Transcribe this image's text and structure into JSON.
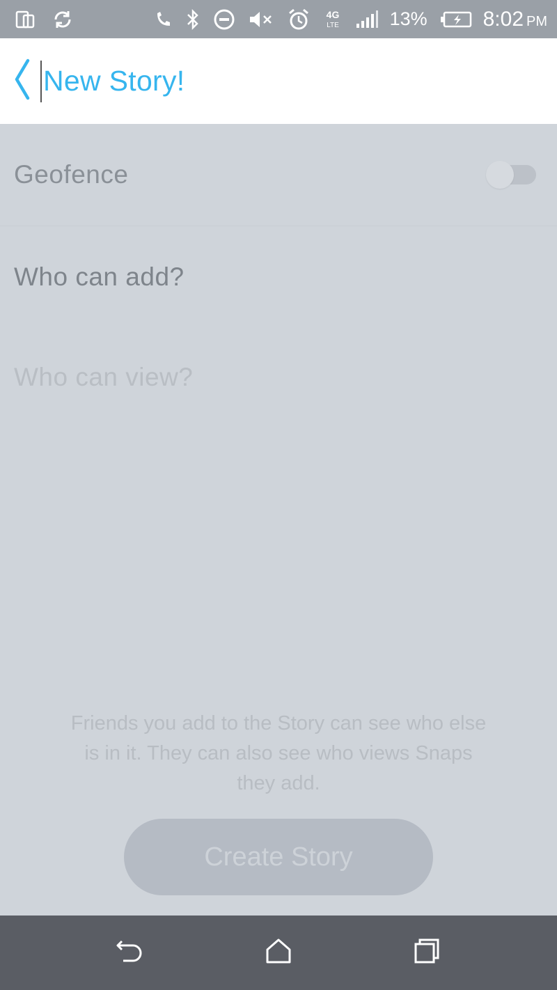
{
  "status_bar": {
    "battery_percent": "13%",
    "time": "8:02",
    "ampm": "PM",
    "network_type": "4G LTE",
    "icons": [
      "screen-mirror-icon",
      "sync-icon",
      "call-icon",
      "bluetooth-icon",
      "do-not-disturb-icon",
      "mute-icon",
      "alarm-icon",
      "network-type-icon",
      "signal-icon",
      "battery-charging-icon"
    ]
  },
  "header": {
    "title": "New Story!",
    "back_icon": "chevron-left-icon"
  },
  "settings": {
    "geofence_label": "Geofence",
    "geofence_enabled": false,
    "who_can_add_label": "Who can add?",
    "who_can_view_label": "Who can view?"
  },
  "footer": {
    "note": "Friends you add to the Story can see who else is in it. They can also see who views Snaps they add.",
    "create_button_label": "Create Story"
  },
  "nav_bar": {
    "icons": [
      "back-icon",
      "home-icon",
      "recents-icon"
    ]
  },
  "colors": {
    "accent": "#36b5ee",
    "background": "#cfd4da",
    "status_bar": "#9aa0a7",
    "nav_bar": "#5a5d64"
  }
}
